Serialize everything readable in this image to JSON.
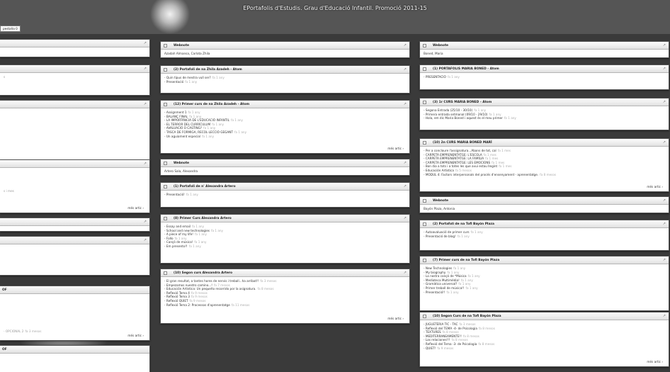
{
  "site": {
    "title": "EPortafolis d'Estudis. Grau d'Educació Infantil. Promoció 2011-15",
    "tab": "pestaña 0"
  },
  "common": {
    "more_label": "més artic",
    "open_icon": "external-arrow-icon"
  },
  "left": {
    "panels": [
      {
        "title": "",
        "items": []
      },
      {
        "title": "",
        "items": [
          "s"
        ]
      },
      {
        "title": "",
        "items": [],
        "more": true
      },
      {
        "title": "",
        "items": [
          "s i mes"
        ],
        "more": true
      },
      {
        "title": "",
        "items": []
      },
      {
        "title": "",
        "items": []
      },
      {
        "title": "OF",
        "items": [
          "OPCIONAL 2"
        ],
        "item_when": [
          "fa 3 mesos"
        ],
        "more": true
      },
      {
        "title": "OF",
        "items": []
      }
    ]
  },
  "middle": {
    "panels": [
      {
        "title": "Webnote",
        "items": [
          "Azadah Almansa, Carlota Zhila"
        ],
        "item_when": [
          ""
        ],
        "more": false
      },
      {
        "title": "(2) Portafoli de na Zhila Azadeh - Atom",
        "items": [
          "Quin tipus de mestra vull ser?",
          "Presentació"
        ],
        "item_when": [
          "fa 1 any",
          "fa 1 any"
        ],
        "more": false
      },
      {
        "title": "(12) Primer curs de na Zhila Azadeh - Atom",
        "items": [
          "Assignment 1",
          "BALANÇ FINAL",
          "LA IMPORTÀNCIA DE L'EDUCACIÓ INFANTIL",
          "EL TERROR DEL CURRÍCULUM",
          "AVALUACIÓ O CASTING?",
          "TASCA DE FORMIGA, RECOL·LECCIÓ GEGANT",
          "Un aguiament especial"
        ],
        "item_when": [
          "fa 1 any",
          "fa 1 any",
          "fa 1 any",
          "fa 1 any",
          "fa 1 any",
          "fa 1 any",
          "fa 1 any"
        ],
        "more": true
      },
      {
        "title": "Webnote",
        "items": [
          "Artero Sala, Alexandra"
        ],
        "item_when": [
          ""
        ],
        "more": false
      },
      {
        "title": "(1) Portafoli de n' Alexandra Artero",
        "items": [
          "Presentació!"
        ],
        "item_when": [
          "fa 1 any"
        ],
        "more": false
      },
      {
        "title": "(8) Primer Curs Alexandra Artero",
        "items": [
          "Essay and email",
          "School and new technologies",
          "A piece of my life!",
          "Follo",
          "Cançó de música!",
          "Em presento!!"
        ],
        "item_when": [
          "fa 1 any",
          "fa 1 any",
          "fa 1 any",
          "fa 1 any",
          "fa 1 any",
          "fa 1 any"
        ],
        "more": false
      },
      {
        "title": "(10) Segon curs Alexandra Artero",
        "items": [
          "El gran resultat, a tantes hores de nervis i treball...ha arribat!!",
          "Empezamos nuestro camino...!",
          "Educación Artística: Un pequeño recorrido por la asignatura.",
          "Reflexió Tema 4",
          "Reflexió Tema 3",
          "Reflexió QUIET",
          "Reflexió Tema 2: Processos d'aprenentatge"
        ],
        "item_when": [
          "fa 3 mesos",
          "fa 7 mesos",
          "fa 8 mesos",
          "fa 9 mesos",
          "fa 9 mesos",
          "fa 9 mesos",
          "fa 11 mesos"
        ],
        "more": true
      }
    ]
  },
  "right": {
    "panels": [
      {
        "title": "Webnote",
        "items": [
          "Boned, Maria"
        ],
        "item_when": [
          ""
        ],
        "more": false
      },
      {
        "title": "(1) PORTAFOLIS MARIA BONED - Atom",
        "items": [
          "PRESENTACIÓ"
        ],
        "item_when": [
          "fa 1 any"
        ],
        "more": false
      },
      {
        "title": "(3) 1r CURS MARIA BONED - Atom",
        "items": [
          "Segona Entrada (25/10 - 30/10)",
          "Primera entrada setmanal (09/10 - 29/10)",
          "Hola, em dic Maria Boned i aquest és el meu primer"
        ],
        "item_when": [
          "fa 1 any",
          "fa 1 any",
          "fa 1 any"
        ],
        "more": false
      },
      {
        "title": "(10) 2n CURS MARIA BONED MARÍ",
        "items": [
          "Per a concloure l'assignatura...Abans de tot, cal",
          "CARPETA EMPRENENTATGE: L'ESCOLA",
          "CARPETA EMPRENENTATGE: LA FAMÍLIA",
          "CARPETA EMPRENENTATGE: LES EMOCIONS",
          "Bon dia a tots i a totes les que avui estau llegint",
          "Educación Artística",
          "MODUL 4: Factors interpersonals del procés d'ensenyament - aprenentatge."
        ],
        "item_when": [
          "fa 1 mes",
          "fa 1 mes",
          "fa 1 mes",
          "fa 1 mes",
          "fa 1 mes",
          "fa 5 mesos",
          "fa 8 mesos"
        ],
        "more": true
      },
      {
        "title": "Webnote",
        "items": [
          "Bayón Plaza, Antonia"
        ],
        "item_when": [
          ""
        ],
        "more": false
      },
      {
        "title": "(2) Portafoli de na Tofi Bayón Plaza",
        "items": [
          "Autoavaluació de primer curs",
          "Presentació de blog!"
        ],
        "item_when": [
          "fa 1 any",
          "fa 1 any"
        ],
        "more": false
      },
      {
        "title": "(7) Primer curs de na Tofi Bayón Plaza",
        "items": [
          "New Technologies",
          "My biography",
          "La nostra cançó de *Música",
          "Mediateca Multimèdia!",
          "Gramàtica universal?",
          "Primer treball de música!!",
          "Presentació!!"
        ],
        "item_when": [
          "fa 1 any",
          "fa 1 any",
          "fa 1 any",
          "fa 1 any",
          "fa 1 any",
          "fa 1 any",
          "fa 1 any"
        ],
        "more": false
      },
      {
        "title": "(10) Segon Curs de na Tofi Bayón Plaza",
        "items": [
          "JUGUETERIA TIC - TAC",
          "Reflexió del TEMA -4- de Psicologia",
          "TEXTURES",
          "MEDITERRANEAMENTE!!",
          "Las relaciones!!!",
          "Reflexió del Tema -3- de Psicologia",
          "QUIET!"
        ],
        "item_when": [
          "fa 3 mesos",
          "fa 8 mesos",
          "fa 8 mesos",
          "fa 8 mesos",
          "fa 8 mesos",
          "fa 8 mesos",
          "fa 9 mesos"
        ],
        "more": true
      }
    ]
  }
}
